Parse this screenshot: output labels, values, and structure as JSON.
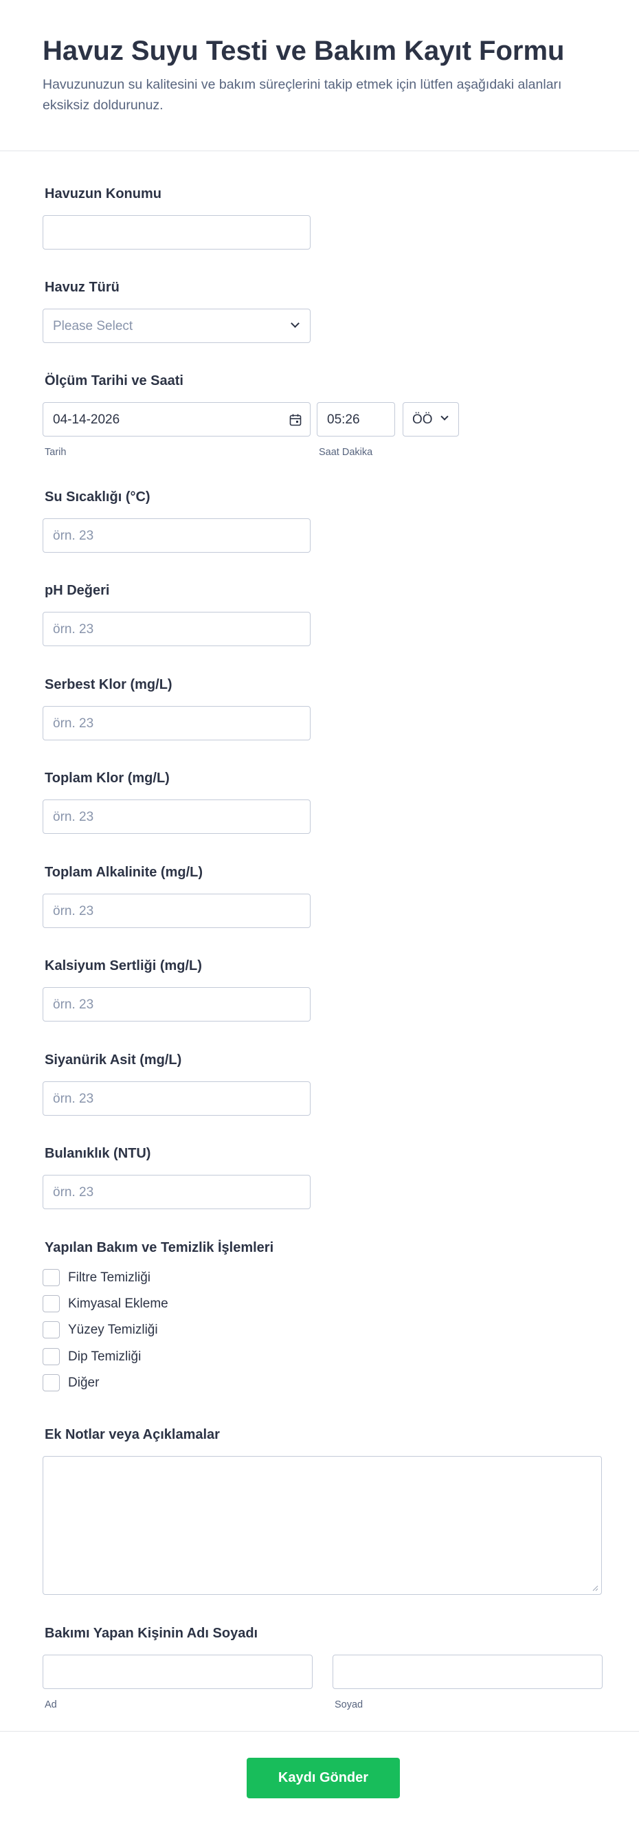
{
  "header": {
    "title": "Havuz Suyu Testi ve Bakım Kayıt Formu",
    "subtitle": "Havuzunuzun su kalitesini ve bakım süreçlerini takip etmek için lütfen aşağıdaki alanları eksiksiz doldurunuz."
  },
  "pool_location": {
    "label": "Havuzun Konumu",
    "value": ""
  },
  "pool_type": {
    "label": "Havuz Türü",
    "placeholder": "Please Select"
  },
  "measurement": {
    "label": "Ölçüm Tarihi ve Saati",
    "date_value": "04-14-2026",
    "time_value": "05:26",
    "ampm_value": "ÖÖ",
    "date_sublabel": "Tarih",
    "time_sublabel": "Saat Dakika"
  },
  "water_temp": {
    "label": "Su Sıcaklığı (°C)",
    "placeholder": "örn. 23"
  },
  "ph": {
    "label": "pH Değeri",
    "placeholder": "örn. 23"
  },
  "free_chlorine": {
    "label": "Serbest Klor (mg/L)",
    "placeholder": "örn. 23"
  },
  "total_chlorine": {
    "label": "Toplam Klor (mg/L)",
    "placeholder": "örn. 23"
  },
  "alkalinity": {
    "label": "Toplam Alkalinite (mg/L)",
    "placeholder": "örn. 23"
  },
  "calcium": {
    "label": "Kalsiyum Sertliği (mg/L)",
    "placeholder": "örn. 23"
  },
  "cyanuric": {
    "label": "Siyanürik Asit (mg/L)",
    "placeholder": "örn. 23"
  },
  "turbidity": {
    "label": "Bulanıklık (NTU)",
    "placeholder": "örn. 23"
  },
  "maintenance": {
    "label": "Yapılan Bakım ve Temizlik İşlemleri",
    "options": [
      "Filtre Temizliği",
      "Kimyasal Ekleme",
      "Yüzey Temizliği",
      "Dip Temizliği",
      "Diğer"
    ]
  },
  "notes": {
    "label": "Ek Notlar veya Açıklamalar",
    "value": ""
  },
  "person": {
    "label": "Bakımı Yapan Kişinin Adı Soyadı",
    "first_sublabel": "Ad",
    "last_sublabel": "Soyad"
  },
  "submit_label": "Kaydı Gönder",
  "colors": {
    "accent": "#18bd5b",
    "text": "#2c3345",
    "muted": "#57647e",
    "border": "#c3cad8"
  }
}
